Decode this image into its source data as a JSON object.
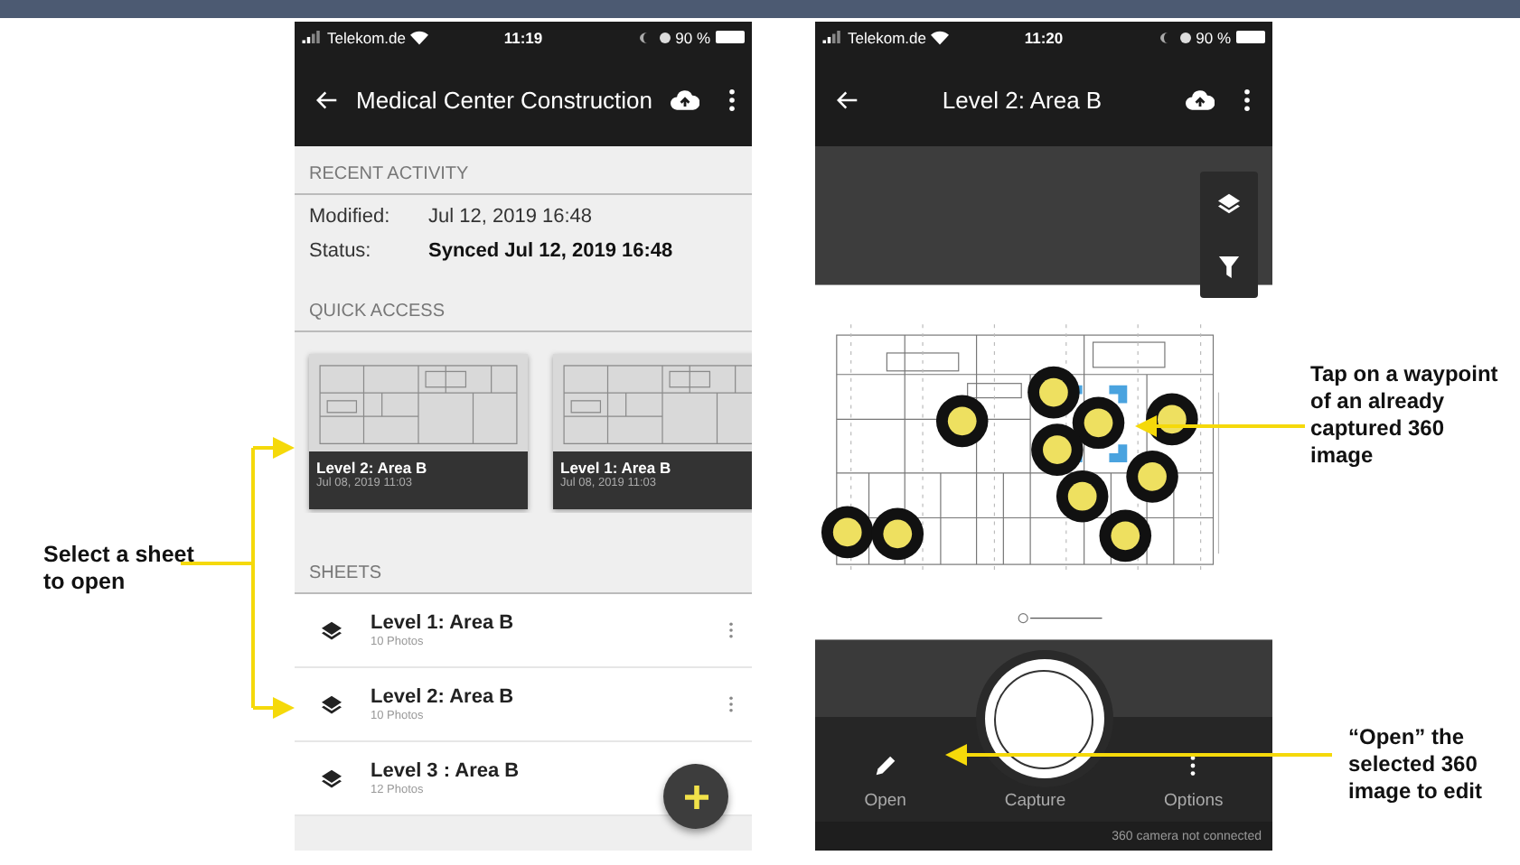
{
  "left_screen": {
    "status_bar": {
      "carrier": "Telekom.de",
      "time": "11:19",
      "battery": "90 %"
    },
    "title": "Medical Center Construction",
    "recent_activity": {
      "heading": "RECENT ACTIVITY",
      "rows": [
        {
          "label": "Modified:",
          "value": "Jul 12, 2019 16:48",
          "emphasis": false
        },
        {
          "label": "Status:",
          "value": "Synced Jul 12, 2019 16:48",
          "emphasis": true
        }
      ]
    },
    "quick_access": {
      "heading": "QUICK ACCESS",
      "cards": [
        {
          "title": "Level 2: Area B",
          "date": "Jul 08, 2019 11:03"
        },
        {
          "title": "Level 1: Area B",
          "date": "Jul 08, 2019 11:03"
        }
      ]
    },
    "sheets": {
      "heading": "SHEETS",
      "items": [
        {
          "name": "Level 1: Area B",
          "photos": "10 Photos",
          "has_menu": true
        },
        {
          "name": "Level 2: Area B",
          "photos": "10 Photos",
          "has_menu": true
        },
        {
          "name": "Level 3 : Area B",
          "photos": "12 Photos",
          "has_menu": false
        }
      ]
    }
  },
  "right_screen": {
    "status_bar": {
      "carrier": "Telekom.de",
      "time": "11:20",
      "battery": "90 %"
    },
    "title": "Level 2: Area B",
    "actions": [
      {
        "label": "Open",
        "kind": "edit"
      },
      {
        "label": "Capture",
        "kind": "capture"
      },
      {
        "label": "Options",
        "kind": "more"
      }
    ],
    "camera_status": "360 camera not connected"
  },
  "annotations": [
    {
      "kind": "sheet",
      "text": "Select a sheet to open"
    },
    {
      "kind": "waypoint",
      "text": "Tap on a waypoint of an already captured 360 image"
    },
    {
      "kind": "open",
      "text": "“Open” the selected 360 image to edit"
    }
  ]
}
